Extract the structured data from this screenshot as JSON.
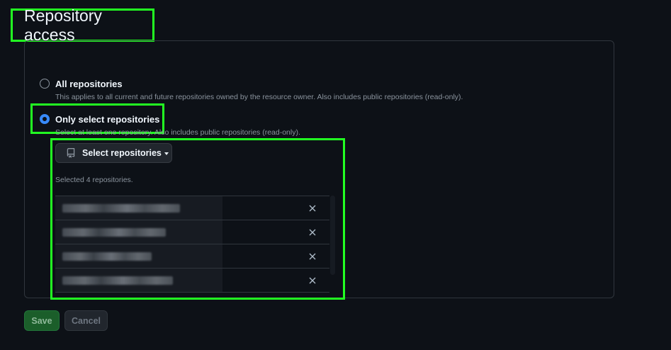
{
  "title": "Repository access",
  "options": [
    {
      "label": "All repositories",
      "description": "This applies to all current and future repositories owned by the resource owner. Also includes public repositories (read-only).",
      "selected": false
    },
    {
      "label": "Only select repositories",
      "description": "Select at least one repository. Also includes public repositories (read-only).",
      "selected": true
    }
  ],
  "select_button": {
    "label": "Select repositories",
    "icon": "repo-icon"
  },
  "selected_count_text": "Selected 4 repositories.",
  "repositories": [
    {
      "name_redacted": true,
      "remove_icon": "close-icon"
    },
    {
      "name_redacted": true,
      "remove_icon": "close-icon"
    },
    {
      "name_redacted": true,
      "remove_icon": "close-icon"
    },
    {
      "name_redacted": true,
      "remove_icon": "close-icon"
    }
  ],
  "actions": {
    "save_label": "Save",
    "cancel_label": "Cancel"
  },
  "colors": {
    "background": "#0d1117",
    "highlight": "#22ff22",
    "radio_accent": "#388bfd",
    "save_bg": "#1b5e2a"
  }
}
